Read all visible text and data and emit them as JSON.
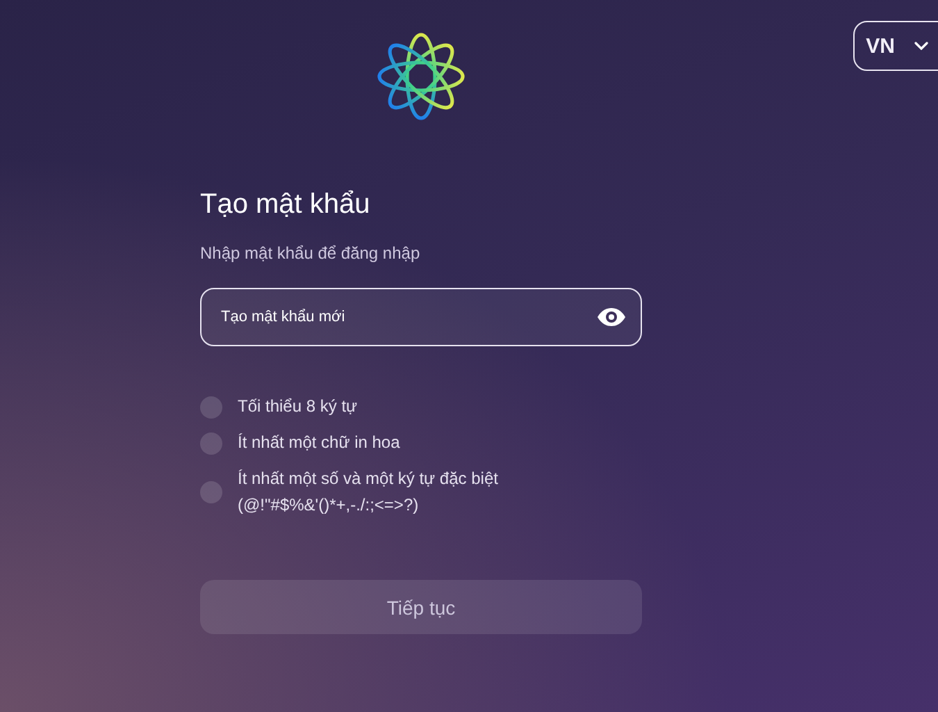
{
  "language": {
    "code": "VN"
  },
  "title": "Tạo mật khẩu",
  "subtitle": "Nhập mật khẩu để đăng nhập",
  "password_field": {
    "placeholder": "Tạo mật khẩu mới"
  },
  "requirements": [
    {
      "text": "Tối thiểu 8 ký tự",
      "met": false
    },
    {
      "text": "Ít nhất một chữ in hoa",
      "met": false
    },
    {
      "text": "Ít nhất một số và một ký tự đặc biệt (@!\"#$%&'()*+,-./:;<=>?)",
      "met": false
    }
  ],
  "continue_button": {
    "label": "Tiếp tục",
    "disabled": true
  }
}
